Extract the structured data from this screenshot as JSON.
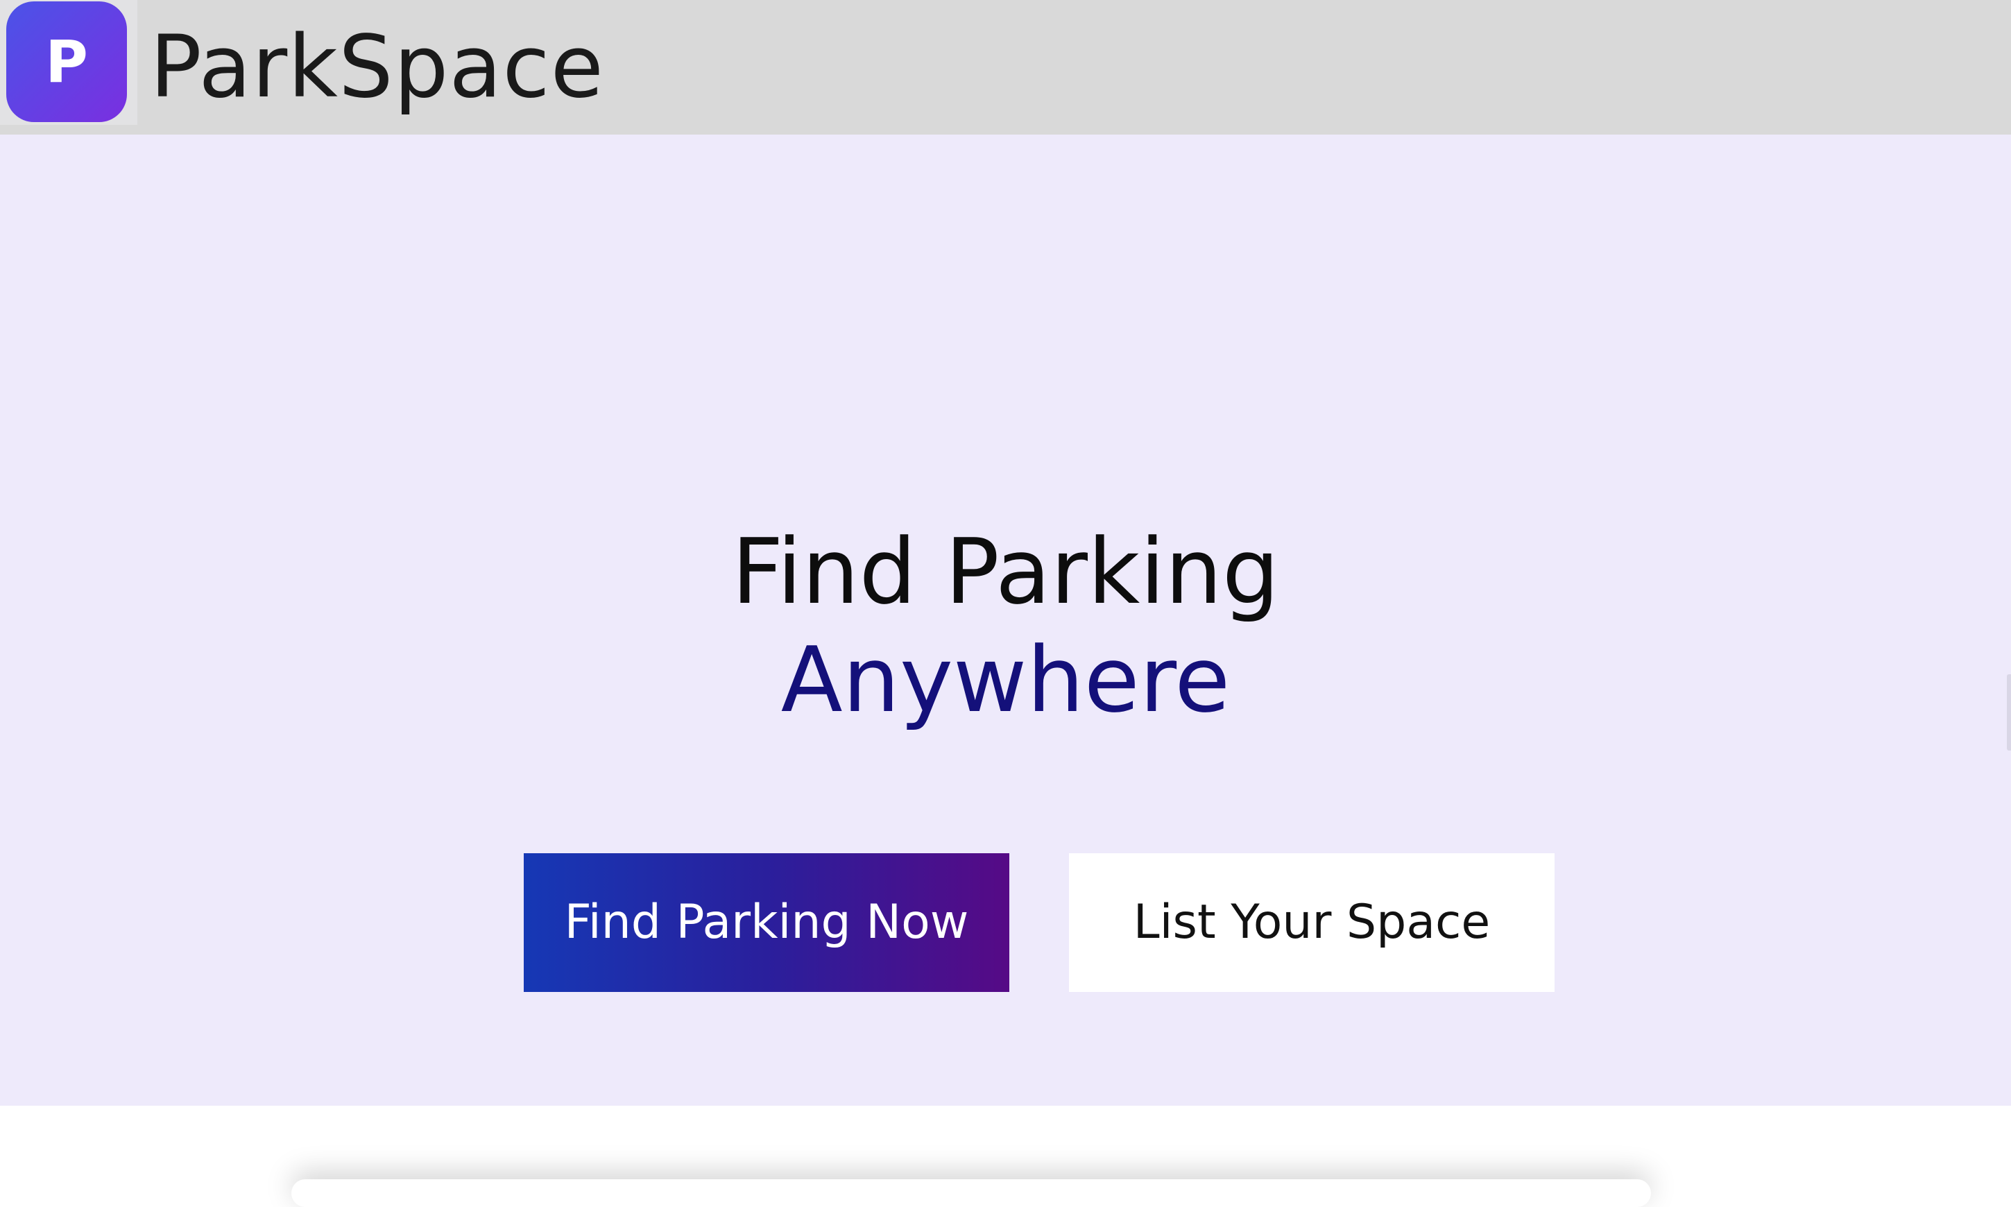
{
  "header": {
    "logo_letter": "P",
    "brand_name": "ParkSpace"
  },
  "hero": {
    "title_line1": "Find Parking",
    "title_line2": "Anywhere",
    "primary_button": "Find Parking Now",
    "secondary_button": "List Your Space"
  },
  "colors": {
    "header_bg": "#d9d9d9",
    "hero_bg": "#eeeafb",
    "accent_dark": "#14107a",
    "gradient_start": "#1638b5",
    "gradient_end": "#560a86",
    "logo_gradient_start": "#4b53e8",
    "logo_gradient_end": "#7a2fe0"
  }
}
